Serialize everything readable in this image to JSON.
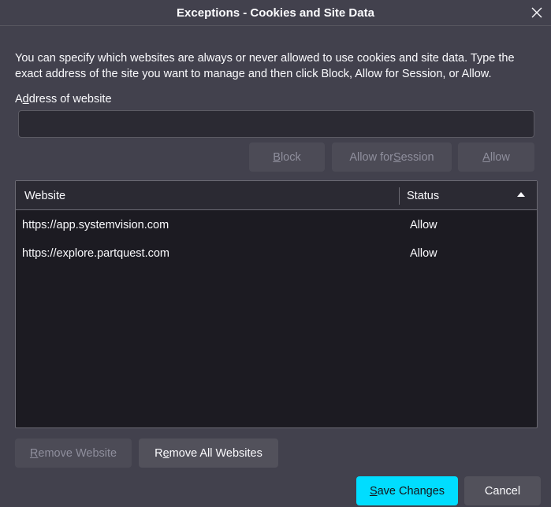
{
  "window": {
    "title": "Exceptions - Cookies and Site Data",
    "close_icon": "close-icon"
  },
  "description": "You can specify which websites are always or never allowed to use cookies and site data. Type the exact address of the site you want to manage and then click Block, Allow for Session, or Allow.",
  "address": {
    "label_pre": "A",
    "label_accel": "d",
    "label_post": "dress of website",
    "value": "",
    "placeholder": ""
  },
  "actions": {
    "block": {
      "pre": "",
      "accel": "B",
      "post": "lock"
    },
    "allow_session": {
      "pre": "Allow for ",
      "accel": "S",
      "post": "ession"
    },
    "allow": {
      "pre": "",
      "accel": "A",
      "post": "llow"
    }
  },
  "table": {
    "columns": [
      "Website",
      "Status"
    ],
    "sort_icon": "sort-ascending-icon",
    "rows": [
      {
        "website": "https://app.systemvision.com",
        "status": "Allow"
      },
      {
        "website": "https://explore.partquest.com",
        "status": "Allow"
      }
    ]
  },
  "footer": {
    "remove_website": {
      "pre": "",
      "accel": "R",
      "post": "emove Website"
    },
    "remove_all": {
      "pre": "R",
      "accel": "e",
      "post": "move All Websites"
    },
    "save": {
      "pre": "",
      "accel": "S",
      "post": "ave Changes"
    },
    "cancel": "Cancel"
  },
  "colors": {
    "background": "#42414d",
    "list_background": "#1c1b22",
    "primary_button": "#00ddff",
    "text": "#fbfbfe",
    "disabled_text": "#8f8f9d"
  }
}
